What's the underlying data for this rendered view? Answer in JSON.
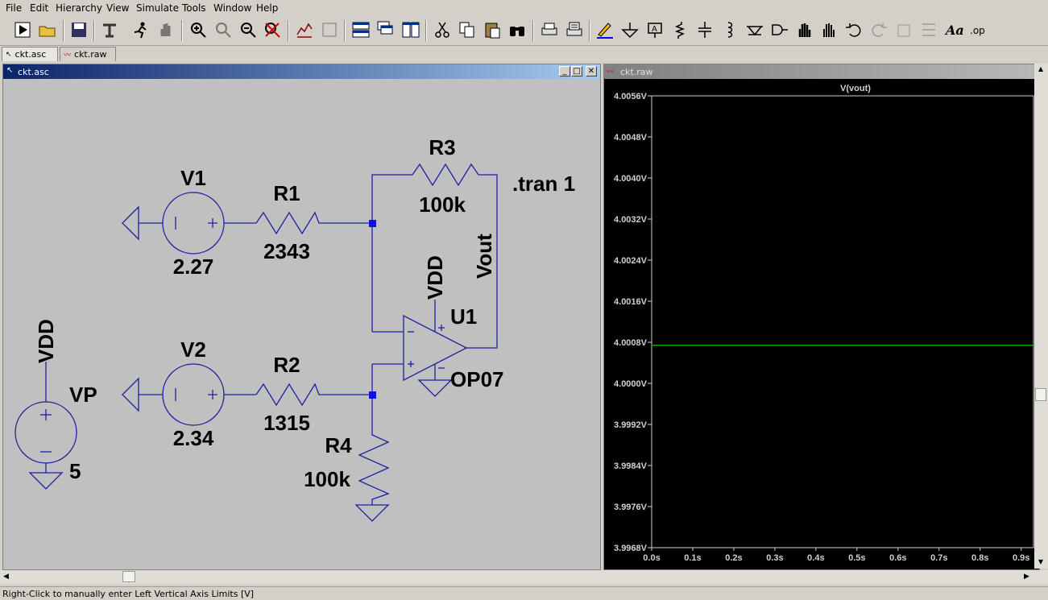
{
  "menu": [
    "File",
    "Edit",
    "Hierarchy",
    "View",
    "Simulate",
    "Tools",
    "Window",
    "Help"
  ],
  "toolbar_icons": [
    "run-icon",
    "open-icon",
    "save-icon",
    "control-panel-icon",
    "halt-icon",
    "pan-icon",
    "zoom-in-icon",
    "zoom-fit-icon",
    "zoom-out-icon",
    "zoom-cancel-icon",
    "autorange-icon",
    "plot-settings-icon",
    "tile-horizontal-icon",
    "cascade-icon",
    "tile-vertical-icon",
    "cut-icon",
    "copy-icon",
    "paste-icon",
    "find-icon",
    "print-setup-icon",
    "print-icon",
    "draw-wire-icon",
    "ground-icon",
    "label-net-icon",
    "resistor-icon",
    "capacitor-icon",
    "inductor-icon",
    "diode-icon",
    "component-icon",
    "move-icon",
    "drag-icon",
    "undo-icon",
    "redo-icon",
    "rotate-icon",
    "mirror-icon",
    "text-icon",
    "spice-directive-icon"
  ],
  "tabs": [
    {
      "label": "ckt.asc"
    },
    {
      "label": "ckt.raw"
    }
  ],
  "schematic": {
    "title": "ckt.asc",
    "labels": {
      "V1": "V1",
      "V1_val": "2.27",
      "R1": "R1",
      "R1_val": "2343",
      "R3": "R3",
      "R3_val": "100k",
      "tran": ".tran 1",
      "vout": "Vout",
      "vdd_op": "VDD",
      "U1": "U1",
      "opamp": "OP07",
      "V2": "V2",
      "V2_val": "2.34",
      "R2": "R2",
      "R2_val": "1315",
      "R4": "R4",
      "R4_val": "100k",
      "vdd_src": "VDD",
      "VP": "VP",
      "VP_val": "5"
    },
    "wire_color": "#2020a0",
    "junction_color": "#1010e0"
  },
  "waveform": {
    "title": "ckt.raw",
    "trace_label": "V(vout)",
    "trace_color": "#00e000"
  },
  "status": "Right-Click to manually enter Left Vertical Axis Limits [V]",
  "chart_data": {
    "type": "line",
    "title": "V(vout)",
    "xlabel": "",
    "ylabel": "",
    "x_ticks": [
      "0.0s",
      "0.1s",
      "0.2s",
      "0.3s",
      "0.4s",
      "0.5s",
      "0.6s",
      "0.7s",
      "0.8s",
      "0.9s"
    ],
    "y_ticks": [
      "4.0056V",
      "4.0048V",
      "4.0040V",
      "4.0032V",
      "4.0024V",
      "4.0016V",
      "4.0008V",
      "4.0000V",
      "3.9992V",
      "3.9984V",
      "3.9976V",
      "3.9968V"
    ],
    "xlim": [
      0,
      0.93
    ],
    "ylim": [
      3.9968,
      4.0056
    ],
    "series": [
      {
        "name": "V(vout)",
        "x": [
          0,
          0.93
        ],
        "y": [
          4.00074,
          4.00074
        ]
      }
    ]
  }
}
